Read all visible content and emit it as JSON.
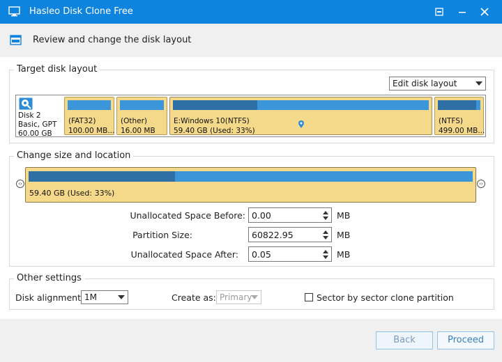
{
  "window": {
    "title": "Hasleo Disk Clone Free",
    "controls": {
      "restore_icon": "restore-window-icon",
      "minimize_icon": "minimize-icon",
      "close_icon": "close-icon"
    }
  },
  "header": {
    "text": "Review and change the disk layout"
  },
  "target_layout": {
    "legend": "Target disk layout",
    "dropdown": "Edit disk layout",
    "disk": {
      "name": "Disk 2",
      "type": "Basic, GPT",
      "size": "60.00 GB"
    },
    "partitions": [
      {
        "name": "(FAT32)",
        "size": "100.00 MB...",
        "used_fraction": 0.0
      },
      {
        "name": "(Other)",
        "size": "16.00 MB",
        "used_fraction": 0.0
      },
      {
        "name": "E:Windows 10(NTFS)",
        "size": "59.40 GB (Used: 33%)",
        "used_fraction": 0.33
      },
      {
        "name": "(NTFS)",
        "size": "499.00 MB...",
        "used_fraction": 0.9
      }
    ]
  },
  "change_size": {
    "legend": "Change size and location",
    "bar_label": "59.40 GB (Used: 33%)",
    "used_fraction": 0.33,
    "fields": [
      {
        "label": "Unallocated Space Before:",
        "value": "0.00",
        "unit": "MB"
      },
      {
        "label": "Partition Size:",
        "value": "60822.95",
        "unit": "MB"
      },
      {
        "label": "Unallocated Space After:",
        "value": "0.05",
        "unit": "MB"
      }
    ]
  },
  "other": {
    "legend": "Other settings",
    "alignment_label": "Disk alignment:",
    "alignment_value": "1M",
    "create_as_label": "Create as:",
    "create_as_value": "Primary",
    "sector_label": "Sector by sector clone partition",
    "sector_checked": false
  },
  "footer": {
    "back": "Back",
    "proceed": "Proceed"
  },
  "colors": {
    "title_bar": "#0f84de",
    "partition_fill": "#f5d98b",
    "bar_free": "#3a96d8",
    "bar_used": "#2e6fa6"
  }
}
